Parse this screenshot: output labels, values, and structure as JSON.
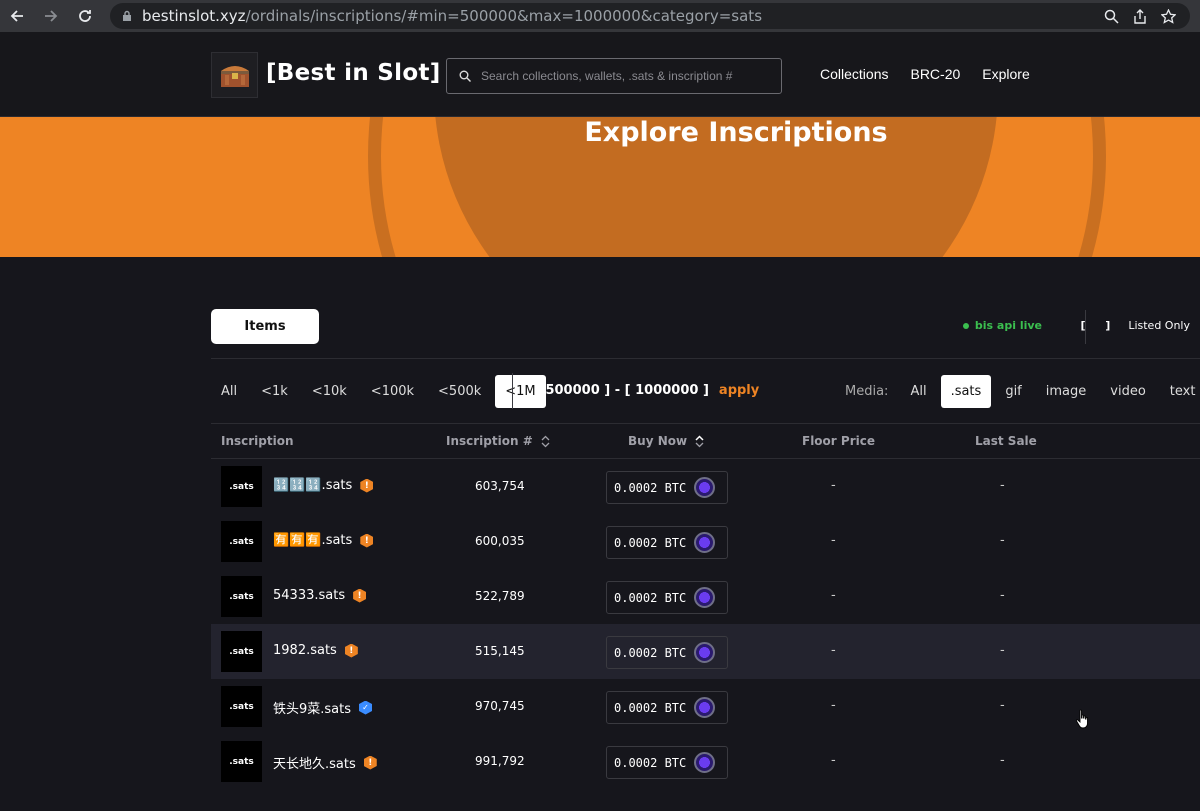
{
  "browser": {
    "url_host": "bestinslot.xyz",
    "url_path": "/ordinals/inscriptions/#min=500000&max=1000000&category=sats"
  },
  "header": {
    "brand": "[Best in Slot]",
    "search_placeholder": "Search collections, wallets, .sats & inscription #",
    "nav": [
      "Collections",
      "BRC-20",
      "Explore"
    ]
  },
  "hero": {
    "title": "Explore Inscriptions"
  },
  "toolbar": {
    "items_label": "Items",
    "live_label": "bis api live",
    "listed_box": "[ ]",
    "listed_label": "Listed Only"
  },
  "filters": {
    "range_tabs": [
      "All",
      "<1k",
      "<10k",
      "<100k",
      "<500k",
      "<1M"
    ],
    "active_range": "<1M",
    "range_text": "[ 500000 ] - [ 1000000 ]",
    "apply_label": "apply",
    "media_label": "Media:",
    "media_tabs": [
      "All",
      ".sats",
      "gif",
      "image",
      "video",
      "text"
    ],
    "active_media": ".sats"
  },
  "table": {
    "columns": [
      "Inscription",
      "Inscription #",
      "Buy Now",
      "Floor Price",
      "Last Sale"
    ],
    "rows": [
      {
        "thumb": ".sats",
        "name": "🔢🔢🔢.sats",
        "badge": "warn",
        "number": "603,754",
        "price": "0.0002 BTC",
        "floor": "-",
        "last": "-"
      },
      {
        "thumb": ".sats",
        "name": "🈶🈶🈶.sats",
        "badge": "warn",
        "number": "600,035",
        "price": "0.0002 BTC",
        "floor": "-",
        "last": "-"
      },
      {
        "thumb": ".sats",
        "name": "54333.sats",
        "badge": "warn",
        "number": "522,789",
        "price": "0.0002 BTC",
        "floor": "-",
        "last": "-"
      },
      {
        "thumb": ".sats",
        "name": "1982.sats",
        "badge": "warn",
        "number": "515,145",
        "price": "0.0002 BTC",
        "floor": "-",
        "last": "-",
        "highlighted": true
      },
      {
        "thumb": ".sats",
        "name": "铁头9菜.sats",
        "badge": "verified",
        "number": "970,745",
        "price": "0.0002 BTC",
        "floor": "-",
        "last": "-"
      },
      {
        "thumb": ".sats",
        "name": "天长地久.sats",
        "badge": "warn",
        "number": "991,792",
        "price": "0.0002 BTC",
        "floor": "-",
        "last": "-"
      }
    ]
  },
  "colors": {
    "accent": "#ee8424",
    "live": "#3bbf4f",
    "background": "#16161c"
  }
}
